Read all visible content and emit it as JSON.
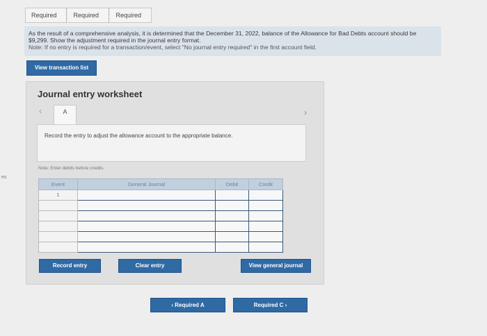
{
  "tabs": [
    "Required A",
    "Required B",
    "Required C"
  ],
  "side_mark": "es",
  "instructions": {
    "text": "As the result of a comprehensive analysis, it is determined that the December 31, 2022, balance of the Allowance for Bad Debts account should be $9,299. Show the adjustment required in the journal entry format.",
    "note": "Note: If no entry is required for a transaction/event, select \"No journal entry required\" in the first account field."
  },
  "view_transaction_list": "View transaction list",
  "worksheet": {
    "title": "Journal entry worksheet",
    "prev_icon": "‹",
    "next_icon": "›",
    "current_tab": "A",
    "record_text": "Record the entry to adjust the allowance account to the appropriate balance.",
    "note_credits": "Note: Enter debits before credits.",
    "table": {
      "headers": [
        "Event",
        "General Journal",
        "Debit",
        "Credit"
      ],
      "rows": [
        {
          "event": "1",
          "account": "",
          "debit": "",
          "credit": ""
        },
        {
          "event": "",
          "account": "",
          "debit": "",
          "credit": ""
        },
        {
          "event": "",
          "account": "",
          "debit": "",
          "credit": ""
        },
        {
          "event": "",
          "account": "",
          "debit": "",
          "credit": ""
        },
        {
          "event": "",
          "account": "",
          "debit": "",
          "credit": ""
        },
        {
          "event": "",
          "account": "",
          "debit": "",
          "credit": ""
        }
      ]
    },
    "buttons": {
      "record": "Record entry",
      "clear": "Clear entry",
      "view_journal": "View general journal"
    }
  },
  "nav": {
    "prev": "‹  Required A",
    "next": "Required C  ›"
  },
  "colors": {
    "button": "#2f6aa5",
    "instruction_bg": "#dbe3ea",
    "table_header": "#c0d0de"
  }
}
